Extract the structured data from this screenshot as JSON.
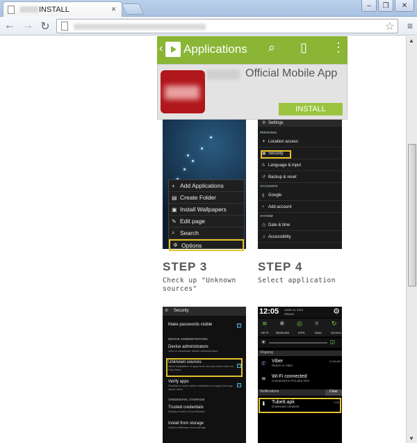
{
  "browser": {
    "tab_title": "INSTALL",
    "tab_close": "×",
    "window_buttons": [
      "–",
      "❐",
      "✕"
    ],
    "nav_back": "←",
    "nav_forward": "→",
    "nav_reload": "↻",
    "star": "☆",
    "menu": "≡"
  },
  "app_header": {
    "title": "Applications",
    "back": "‹",
    "search_icon": "⌕",
    "bookmark_icon": "▯",
    "more_icon": "⋮",
    "accent": "#8ab535"
  },
  "app_card": {
    "name": "Official Mobile App",
    "install_label": "INSTALL",
    "icon_color": "#b0161b"
  },
  "step1": {
    "menu_items": [
      {
        "icon": "+",
        "label": "Add Applications"
      },
      {
        "icon": "▤",
        "label": "Create Folder"
      },
      {
        "icon": "▣",
        "label": "Install Wallpapers"
      },
      {
        "icon": "✎",
        "label": "Edit page"
      },
      {
        "icon": "⌕",
        "label": "Search"
      },
      {
        "icon": "✲",
        "label": "Options"
      }
    ]
  },
  "step2": {
    "header": "Settings",
    "section_personal": "PERSONAL",
    "section_accounts": "ACCOUNTS",
    "section_system": "SYSTEM",
    "rows": {
      "location": "Location access",
      "security": "Security",
      "language": "Language & input",
      "backup": "Backup & reset",
      "google": "Google",
      "add_account": "Add account",
      "datetime": "Date & time",
      "accessibility": "Accessibility"
    }
  },
  "step3": {
    "title": "STEP 3",
    "text_line1": "Check up \"Unknown",
    "text_line2": "sources\"",
    "screen": {
      "header": "Security",
      "make_passwords": "Make passwords visible",
      "device_admin_head": "DEVICE ADMINISTRATION",
      "device_admins": "Device administrators",
      "device_admins_sub": "View or deactivate device administrators",
      "unknown_sources": "Unknown sources",
      "unknown_sources_sub": "Allow installation of apps from sources other than the Play Store",
      "verify_apps": "Verify apps",
      "verify_apps_sub": "Disallow or warn before installation of apps that may cause harm",
      "cred_head": "CREDENTIAL STORAGE",
      "trusted": "Trusted credentials",
      "trusted_sub": "Display trusted CA certificates",
      "install_storage": "Install from storage",
      "install_storage_sub": "Install certificates from storage"
    }
  },
  "step4": {
    "title": "STEP 4",
    "text_line1": "Select application",
    "screen": {
      "time": "12:05",
      "date": "JUNE 14, 2013",
      "day": "FRIDAY",
      "toggles": [
        "Wi-Fi",
        "Bluetooth",
        "GPS",
        "Mute",
        "Screen rotation"
      ],
      "ongoing_head": "Ongoing",
      "viber": "Viber",
      "viber_sub": "Return to Viber",
      "viber_time": "11:56 AM",
      "wifi": "Wi-Fi connected",
      "wifi_sub": "Connected to PCLabs-Test",
      "notifications_head": "Notifications",
      "clear": "Clear",
      "apk": "Tube8.apk",
      "apk_sub": "Download complete.",
      "apk_time": "9:36"
    }
  },
  "step_labels": {
    "step1_title_hidden": "",
    "step2_title_hidden": ""
  }
}
